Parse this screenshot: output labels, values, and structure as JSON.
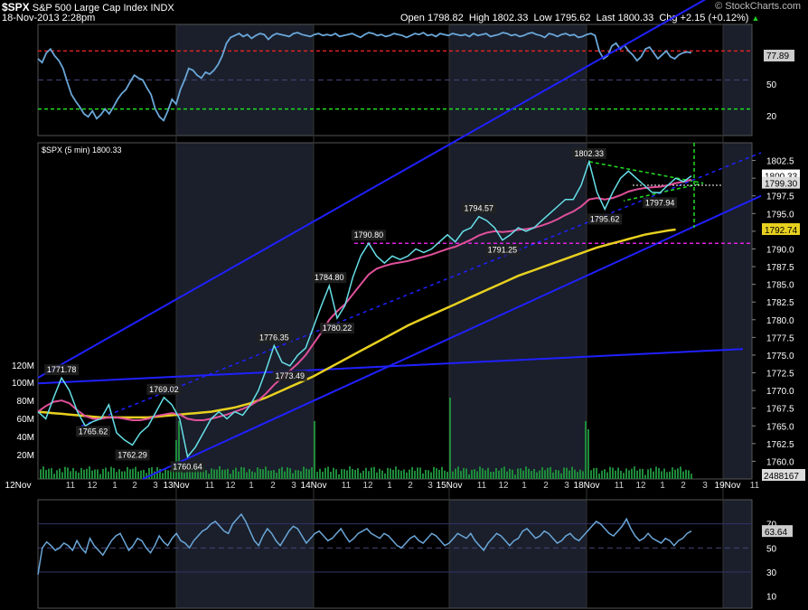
{
  "header": {
    "symbol": "$SPX",
    "name": "S&P 500 Large Cap Index",
    "exchange": "INDX",
    "datetime": "18-Nov-2013 2:28pm",
    "open_label": "Open",
    "open": "1798.82",
    "high_label": "High",
    "high": "1802.33",
    "low_label": "Low",
    "low": "1795.62",
    "last_label": "Last",
    "last": "1800.33",
    "chg_label": "Chg",
    "chg": "+2.15 (+0.12%)",
    "watermark": "© StockCharts.com"
  },
  "colors": {
    "price": "#66e0e8",
    "ema_fast": "#e0509a",
    "ema_slow": "#e8d020",
    "channel": "#2020ff",
    "triangle": "#22dd22",
    "resistance": "#dd22dd",
    "rsi": "#6aa6d8",
    "overbought": "#dd2222",
    "oversold": "#22dd22",
    "volume": "#1e8a3a",
    "session_shade": "#1a1f2b"
  },
  "chart_data": [
    {
      "type": "line",
      "panel": "stochastic-top",
      "ylim": [
        0,
        100
      ],
      "y_ticks": [
        "77.89",
        "50",
        "20"
      ],
      "levels": {
        "overbought": 80,
        "oversold": 20,
        "mid": 50
      },
      "current_value": "77.89",
      "x": [
        0,
        1,
        2,
        3,
        4,
        5,
        6,
        7,
        8,
        9,
        10,
        11,
        12,
        13,
        14,
        15,
        16,
        17,
        18,
        19,
        20,
        21,
        22,
        23,
        24,
        25,
        26,
        27,
        28,
        29,
        30,
        31,
        32,
        33,
        34,
        35,
        36,
        37,
        38,
        39,
        40,
        41,
        42,
        43,
        44,
        45,
        46,
        47,
        48,
        49,
        50,
        51,
        52,
        53,
        54,
        55,
        56,
        57,
        58,
        59,
        60,
        61,
        62,
        63,
        64,
        65,
        66,
        67,
        68,
        69,
        70,
        71,
        72,
        73,
        74,
        75,
        76,
        77,
        78,
        79,
        80,
        81,
        82,
        83,
        84,
        85,
        86,
        87,
        88,
        89,
        90,
        91,
        92,
        93,
        94,
        95,
        96,
        97,
        98,
        99,
        100,
        101,
        102,
        103,
        104,
        105,
        106,
        107,
        108,
        109,
        110,
        111,
        112,
        113,
        114,
        115,
        116,
        117,
        118,
        119,
        120,
        121,
        122,
        123,
        124,
        125,
        126,
        127,
        128,
        129,
        130,
        131,
        132,
        133,
        134,
        135,
        136,
        137,
        138,
        139,
        140,
        141,
        142,
        143,
        144,
        145,
        146,
        147,
        148,
        149,
        150,
        151,
        152,
        153,
        154,
        155,
        156
      ],
      "y": [
        72,
        68,
        78,
        82,
        75,
        70,
        62,
        48,
        35,
        28,
        22,
        15,
        12,
        18,
        10,
        14,
        20,
        15,
        22,
        30,
        36,
        40,
        48,
        55,
        52,
        50,
        42,
        35,
        20,
        12,
        8,
        18,
        30,
        25,
        40,
        50,
        62,
        60,
        55,
        52,
        58,
        56,
        60,
        66,
        75,
        88,
        94,
        96,
        98,
        95,
        97,
        93,
        96,
        98,
        97,
        92,
        96,
        98,
        97,
        96,
        95,
        98,
        99,
        97,
        96,
        95,
        97,
        98,
        96,
        97,
        96,
        98,
        95,
        96,
        97,
        98,
        96,
        94,
        97,
        99,
        98,
        96,
        97,
        95,
        96,
        98,
        97,
        96,
        94,
        96,
        98,
        97,
        99,
        96,
        97,
        95,
        98,
        97,
        96,
        98,
        97,
        96,
        97,
        95,
        98,
        96,
        97,
        98,
        95,
        96,
        97,
        99,
        98,
        96,
        97,
        95,
        96,
        98,
        99,
        97,
        96,
        94,
        98,
        97,
        95,
        97,
        98,
        96,
        97,
        94,
        95,
        97,
        98,
        96,
        80,
        72,
        75,
        85,
        88,
        82,
        86,
        80,
        76,
        70,
        74,
        82,
        84,
        78,
        72,
        76,
        80,
        74,
        72,
        76,
        78,
        79,
        78
      ]
    },
    {
      "type": "line",
      "panel": "price",
      "title": "$SPX (5 min) 1800.33",
      "ylim": [
        1757.5,
        1805
      ],
      "y_ticks": [
        1760,
        1762.5,
        1765,
        1767.5,
        1770,
        1772.5,
        1775,
        1777.5,
        1780,
        1782.5,
        1785,
        1787.5,
        1790,
        1792.5,
        1795,
        1797.5,
        1800,
        1802.5
      ],
      "x_labels": [
        "12Nov",
        "11",
        "12",
        "1",
        "2",
        "3",
        "13Nov",
        "11",
        "12",
        "1",
        "2",
        "3",
        "14Nov",
        "11",
        "12",
        "1",
        "2",
        "3",
        "15Nov",
        "11",
        "12",
        "1",
        "2",
        "3",
        "18Nov",
        "11",
        "12",
        "1",
        "2",
        "3",
        "19Nov",
        "11"
      ],
      "price_tags": [
        "1800.33",
        "1799.30",
        "1792.74"
      ],
      "annotations": [
        "1771.78",
        "1765.62",
        "1769.02",
        "1762.29",
        "1760.64",
        "1776.35",
        "1773.49",
        "1784.80",
        "1780.22",
        "1790.80",
        "1794.57",
        "1791.25",
        "1802.33",
        "1795.62",
        "1797.94"
      ],
      "volume_labels": [
        "120M",
        "100M",
        "80M",
        "60M",
        "40M",
        "20M"
      ],
      "volume_last": "2488167",
      "series": [
        {
          "values": [
            1767,
            1766,
            1769,
            1771.78,
            1770,
            1767,
            1765,
            1765.62,
            1766,
            1768,
            1764,
            1763,
            1762.29,
            1764,
            1765,
            1767,
            1769.02,
            1768,
            1766,
            1760.64,
            1762,
            1764,
            1766,
            1767,
            1766,
            1767,
            1766.5,
            1768,
            1770,
            1773,
            1776.35,
            1774,
            1773.49,
            1775,
            1776,
            1779,
            1782,
            1784.8,
            1780.22,
            1782,
            1786,
            1789,
            1790.8,
            1789,
            1788,
            1789,
            1788.5,
            1789,
            1790,
            1789.5,
            1790,
            1791,
            1792,
            1791,
            1792.5,
            1793,
            1794.57,
            1794,
            1793,
            1791.25,
            1792,
            1793,
            1792.5,
            1793,
            1794,
            1795,
            1796,
            1797,
            1797,
            1799,
            1802.33,
            1798,
            1795.62,
            1798,
            1800,
            1801,
            1800,
            1799,
            1798,
            1797.94,
            1799,
            1800,
            1799.5,
            1800.33
          ]
        },
        {
          "values": [
            1767,
            1767.8,
            1768.4,
            1768.6,
            1768.2,
            1767.2,
            1766.4,
            1766,
            1766,
            1766.2,
            1766.2,
            1766,
            1765.8,
            1765.8,
            1766,
            1766.4,
            1766.6,
            1766.8,
            1766.6,
            1766,
            1765.8,
            1765.8,
            1766,
            1766.3,
            1766.6,
            1767,
            1767.4,
            1767.9,
            1768.6,
            1769.6,
            1770.8,
            1771.8,
            1772.8,
            1773.8,
            1775,
            1776.6,
            1778.2,
            1780,
            1781.2,
            1782.2,
            1783.6,
            1785,
            1786.4,
            1787.2,
            1787.6,
            1787.9,
            1788.1,
            1788.3,
            1788.6,
            1788.9,
            1789.2,
            1789.6,
            1790,
            1790.3,
            1790.8,
            1791.3,
            1791.9,
            1792.3,
            1792.5,
            1792.4,
            1792.5,
            1792.7,
            1792.8,
            1793,
            1793.3,
            1793.7,
            1794.2,
            1794.8,
            1795.3,
            1796,
            1797,
            1797.2,
            1797,
            1797.2,
            1797.6,
            1798.1,
            1798.4,
            1798.6,
            1798.7,
            1798.8,
            1799,
            1799.3,
            1799.5,
            1799.8
          ]
        },
        {
          "values": [
            1767,
            1766.9,
            1766.8,
            1766.7,
            1766.6,
            1766.5,
            1766.4,
            1766.3,
            1766.2,
            1766.2,
            1766.2,
            1766.2,
            1766.2,
            1766.2,
            1766.2,
            1766.3,
            1766.4,
            1766.5,
            1766.6,
            1766.7,
            1766.8,
            1766.9,
            1767,
            1767.2,
            1767.4,
            1767.6,
            1767.9,
            1768.2,
            1768.6,
            1769,
            1769.5,
            1770,
            1770.5,
            1771,
            1771.5,
            1772,
            1772.6,
            1773.2,
            1773.8,
            1774.4,
            1775,
            1775.6,
            1776.2,
            1776.8,
            1777.4,
            1778,
            1778.6,
            1779.2,
            1779.7,
            1780.2,
            1780.7,
            1781.2,
            1781.7,
            1782.2,
            1782.7,
            1783.2,
            1783.7,
            1784.2,
            1784.7,
            1785.2,
            1785.7,
            1786.2,
            1786.6,
            1787,
            1787.4,
            1787.8,
            1788.2,
            1788.6,
            1789,
            1789.4,
            1789.8,
            1790.2,
            1790.5,
            1790.8,
            1791.1,
            1791.4,
            1791.7,
            1792,
            1792.2,
            1792.4,
            1792.6,
            1792.74
          ]
        }
      ]
    },
    {
      "type": "line",
      "panel": "rsi-bottom",
      "ylim": [
        0,
        90
      ],
      "y_ticks": [
        "70",
        "63.64",
        "50",
        "30",
        "10"
      ],
      "current_value": "63.64",
      "y": [
        28,
        50,
        55,
        52,
        48,
        50,
        54,
        52,
        48,
        56,
        50,
        46,
        58,
        52,
        48,
        44,
        50,
        56,
        60,
        62,
        55,
        48,
        52,
        58,
        56,
        50,
        46,
        52,
        60,
        55,
        52,
        58,
        62,
        56,
        54,
        50,
        56,
        60,
        64,
        66,
        70,
        72,
        68,
        64,
        62,
        70,
        74,
        78,
        72,
        64,
        56,
        52,
        60,
        66,
        62,
        56,
        52,
        58,
        64,
        68,
        66,
        60,
        54,
        58,
        62,
        64,
        60,
        56,
        58,
        62,
        66,
        60,
        55,
        58,
        62,
        64,
        66,
        62,
        60,
        58,
        62,
        60,
        56,
        52,
        50,
        54,
        58,
        60,
        56,
        54,
        58,
        62,
        60,
        56,
        52,
        54,
        58,
        62,
        60,
        58,
        62,
        56,
        52,
        48,
        54,
        58,
        62,
        60,
        56,
        52,
        56,
        58,
        64,
        66,
        62,
        58,
        60,
        64,
        62,
        58,
        54,
        56,
        60,
        62,
        58,
        56,
        60,
        64,
        68,
        72,
        70,
        66,
        62,
        60,
        64,
        68,
        74,
        66,
        60,
        56,
        58,
        62,
        58,
        56,
        54,
        58,
        56,
        52,
        56,
        58,
        62,
        64
      ]
    }
  ]
}
